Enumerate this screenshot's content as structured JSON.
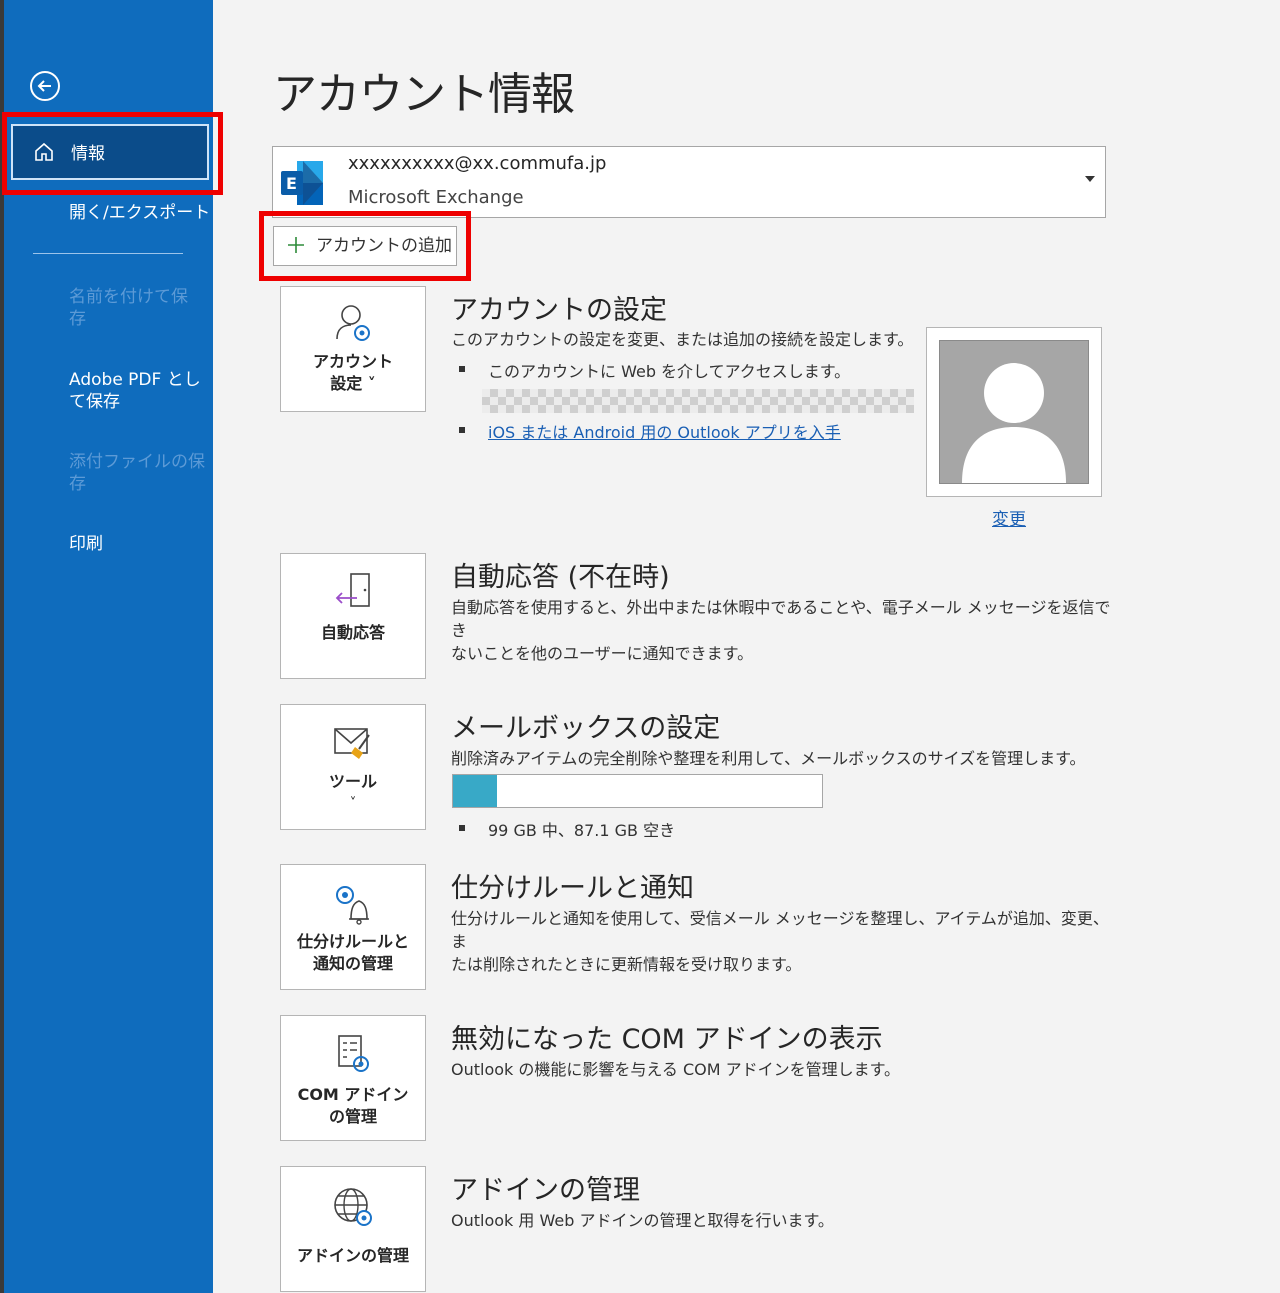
{
  "sidebar": {
    "back_label": "戻る",
    "items": [
      {
        "label": "情報",
        "state": "selected"
      },
      {
        "label": "開く/エクスポート",
        "state": "enabled"
      },
      {
        "label": "名前を付けて保存",
        "state": "disabled"
      },
      {
        "label": "Adobe PDF として保存",
        "state": "enabled"
      },
      {
        "label": "添付ファイルの保存",
        "state": "disabled"
      },
      {
        "label": "印刷",
        "state": "enabled"
      }
    ],
    "item_lines": {
      "save_as": [
        "名前を付けて保",
        "存"
      ],
      "adobe": [
        "Adobe PDF とし",
        "て保存"
      ],
      "attach": [
        "添付ファイルの保",
        "存"
      ]
    }
  },
  "page": {
    "title": "アカウント情報"
  },
  "account": {
    "email": "xxxxxxxxxx@xx.commufa.jp",
    "type": "Microsoft Exchange",
    "add_label": "アカウントの追加"
  },
  "sections": {
    "account_settings": {
      "tile_lines": [
        "アカウント",
        "設定 ˅"
      ],
      "title": "アカウントの設定",
      "desc": "このアカウントの設定を変更、または追加の接続を設定します。",
      "bullet1": "このアカウントに Web を介してアクセスします。",
      "bullet2_link": "iOS または Android 用の Outlook アプリを入手",
      "change_link": "変更"
    },
    "auto_reply": {
      "tile_label": "自動応答",
      "title": "自動応答 (不在時)",
      "desc_lines": [
        "自動応答を使用すると、外出中または休暇中であることや、電子メール メッセージを返信でき",
        "ないことを他のユーザーに通知できます。"
      ]
    },
    "mailbox": {
      "tile_lines": [
        "ツール",
        "˅"
      ],
      "title": "メールボックスの設定",
      "desc": "削除済みアイテムの完全削除や整理を利用して、メールボックスのサイズを管理します。",
      "quota_text": "99 GB 中、87.1 GB 空き",
      "used_fraction": 0.12
    },
    "rules": {
      "tile_lines": [
        "仕分けルールと",
        "通知の管理"
      ],
      "title": "仕分けルールと通知",
      "desc_lines": [
        "仕分けルールと通知を使用して、受信メール メッセージを整理し、アイテムが追加、変更、ま",
        "たは削除されたときに更新情報を受け取ります。"
      ]
    },
    "com_addins": {
      "tile_lines": [
        "COM アドイン",
        "の管理"
      ],
      "title": "無効になった COM アドインの表示",
      "desc": "Outlook の機能に影響を与える COM アドインを管理します。"
    },
    "addins": {
      "tile_label": "アドインの管理",
      "title": "アドインの管理",
      "desc": "Outlook 用 Web アドインの管理と取得を行います。"
    }
  },
  "colors": {
    "sidebar": "#0f6cbd",
    "selected": "#0b4c8a",
    "highlight": "#ee0000",
    "quota": "#38a9c7"
  }
}
